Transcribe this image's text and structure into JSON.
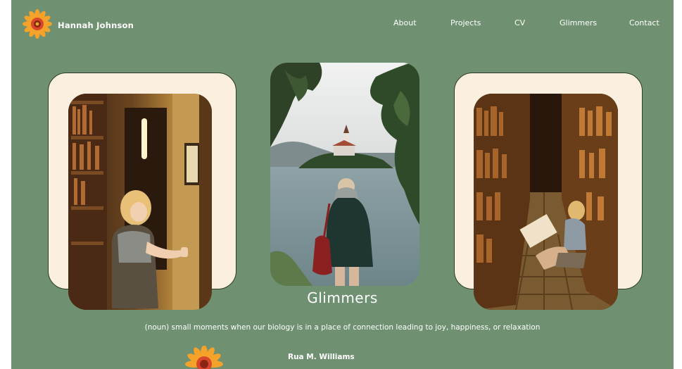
{
  "header": {
    "name": "Hannah Johnson",
    "logo_icon": "flower-icon"
  },
  "nav": {
    "items": [
      {
        "label": "About"
      },
      {
        "label": "Projects"
      },
      {
        "label": "CV"
      },
      {
        "label": "Glimmers"
      },
      {
        "label": "Contact"
      }
    ]
  },
  "hero": {
    "title": "Glimmers",
    "definition": "(noun) small moments when our biology is in a place of connection leading to joy, happiness, or relaxation",
    "quote_author": "Rua M. Williams"
  },
  "photos": [
    {
      "subject": "bookshop-aisle-photo"
    },
    {
      "subject": "lake-island-church-photo"
    },
    {
      "subject": "library-floor-reading-photo"
    }
  ],
  "colors": {
    "background": "#6f9171",
    "card": "#fbf0df",
    "text": "#ffffff",
    "flower_petals": "#f29a1f",
    "flower_center": "#c8341d"
  }
}
